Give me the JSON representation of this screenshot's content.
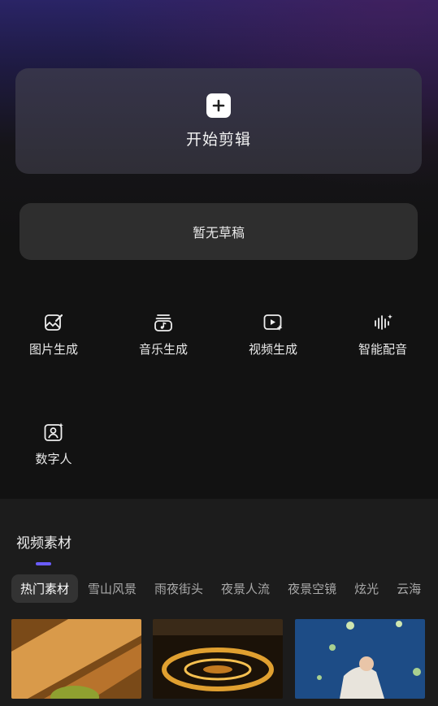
{
  "start": {
    "label": "开始剪辑",
    "icon": "plus-icon"
  },
  "draft": {
    "label": "暂无草稿"
  },
  "tools": [
    {
      "label": "图片生成",
      "icon": "image-edit-icon"
    },
    {
      "label": "音乐生成",
      "icon": "music-icon"
    },
    {
      "label": "视频生成",
      "icon": "video-sparkle-icon"
    },
    {
      "label": "智能配音",
      "icon": "voice-wave-icon"
    },
    {
      "label": "数字人",
      "icon": "digital-human-icon"
    }
  ],
  "material": {
    "title": "视频素材",
    "tabs": [
      "热门素材",
      "雪山风景",
      "雨夜街头",
      "夜景人流",
      "夜景空镜",
      "炫光",
      "云海"
    ],
    "active_tab": "热门素材"
  },
  "colors": {
    "accent": "#6a5cff",
    "card": "#2e2e2e",
    "background": "#121212"
  }
}
